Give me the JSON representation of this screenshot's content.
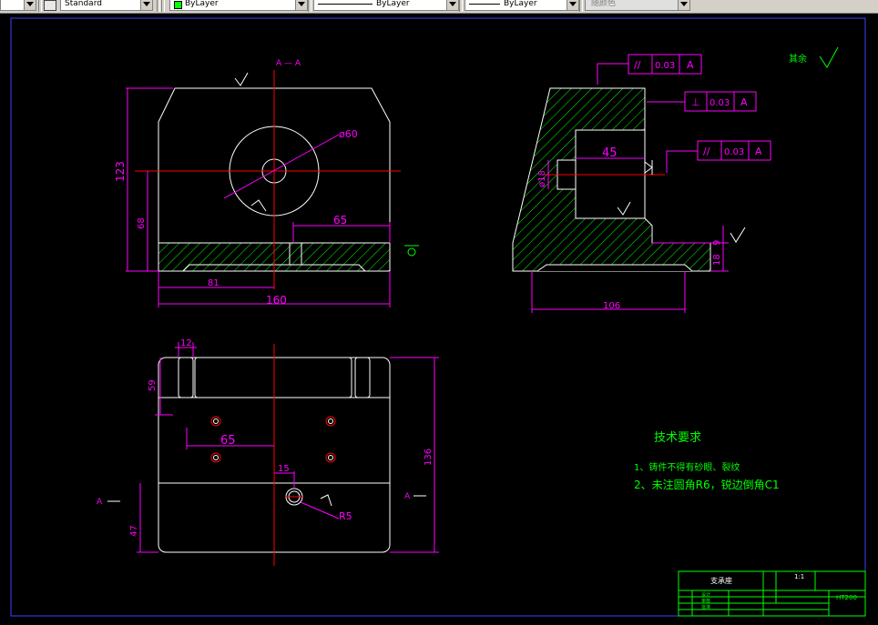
{
  "toolbar": {
    "text_style": "Standard",
    "color": "ByLayer",
    "linetype": "ByLayer",
    "lineweight": "ByLayer",
    "plot_style": "随颜色"
  },
  "colors": {
    "background": "#000000",
    "geometry": "#ffffff",
    "dimension": "#ff00ff",
    "centerline": "#ff0000",
    "hatch": "#00ff00",
    "text_green": "#00ff00",
    "frame": "#0000ff"
  },
  "drawing": {
    "section_label_top": "A — A",
    "roughness_other": "其余",
    "front_view": {
      "dim_diameter": "ø60",
      "dim_overall_height": "123",
      "dim_lower_height": "68",
      "dim_bore_offset": "65",
      "dim_center_x": "81",
      "dim_overall_width": "160"
    },
    "section_view": {
      "tol1_symbol": "//",
      "tol1_value": "0.03",
      "tol1_datum": "A",
      "tol2_symbol": "⊥",
      "tol2_value": "0.03",
      "tol2_datum": "A",
      "tol3_symbol": "//",
      "tol3_value": "0.03",
      "tol3_datum": "A",
      "dim_hole_depth": "45",
      "dim_hole_dia": "ø18",
      "dim_step_9": "9",
      "dim_base_18": "18",
      "dim_base_width": "106"
    },
    "top_view": {
      "dim_slot_12": "12",
      "dim_depth_59": "59",
      "dim_hole_65": "65",
      "dim_15": "15",
      "dim_height_136": "136",
      "dim_47": "47",
      "dim_r5": "R5",
      "section_mark_left": "A",
      "section_mark_right": "A"
    },
    "tech_req_title": "技术要求",
    "tech_req_1": "1、铸件不得有砂眼、裂纹",
    "tech_req_2": "2、未注圆角R6，锐边倒角C1"
  },
  "title_block": {
    "part_name": "支承座",
    "scale": "1:1",
    "material": "HT200",
    "designer": "设计",
    "checker": "审核",
    "approver": "批准"
  }
}
